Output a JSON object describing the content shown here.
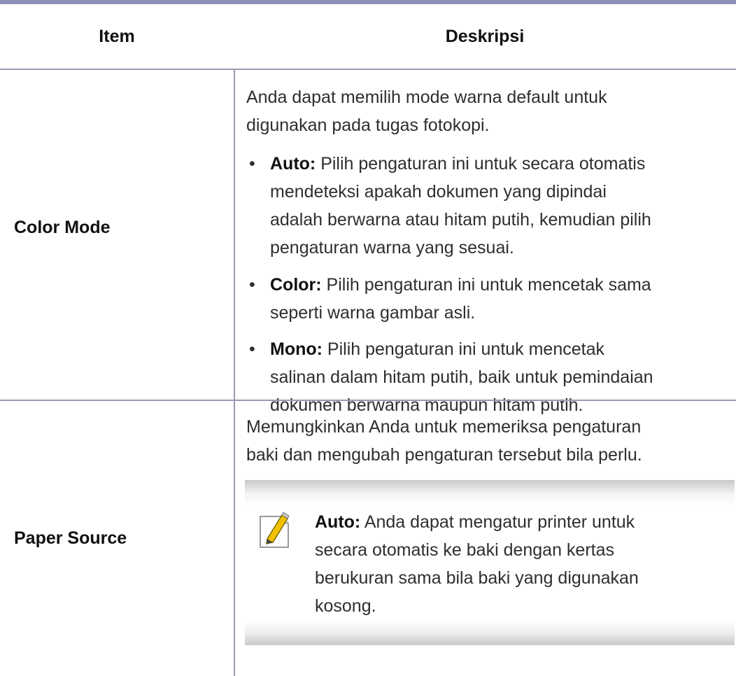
{
  "table": {
    "headers": {
      "item": "Item",
      "description": "Deskripsi"
    },
    "rows": [
      {
        "item": "Color Mode",
        "intro_line1": "Anda dapat memilih mode warna default untuk",
        "intro_line2": "digunakan pada tugas fotokopi.",
        "bullets": [
          {
            "term": "Auto:",
            "lines": [
              " Pilih pengaturan ini untuk secara otomatis",
              "mendeteksi apakah dokumen yang dipindai",
              "adalah berwarna atau hitam putih, kemudian pilih",
              "pengaturan warna yang sesuai."
            ]
          },
          {
            "term": "Color:",
            "lines": [
              " Pilih pengaturan ini untuk mencetak sama",
              "seperti warna gambar asli."
            ]
          },
          {
            "term": "Mono:",
            "lines": [
              " Pilih pengaturan ini untuk mencetak",
              "salinan dalam hitam putih, baik untuk pemindaian",
              "dokumen berwarna maupun hitam putih."
            ]
          }
        ]
      },
      {
        "item": "Paper Source",
        "intro_line1": "Memungkinkan Anda untuk memeriksa pengaturan",
        "intro_line2": "baki dan mengubah pengaturan tersebut bila perlu.",
        "note": {
          "icon": "note-pencil-icon",
          "term": "Auto:",
          "lines": [
            " Anda dapat mengatur printer untuk",
            "secara otomatis ke baki dengan kertas",
            "berukuran sama bila baki yang digunakan",
            "kosong."
          ]
        }
      }
    ]
  },
  "colors": {
    "rule": "#8c8fb9",
    "divider": "#9a9ab4"
  }
}
